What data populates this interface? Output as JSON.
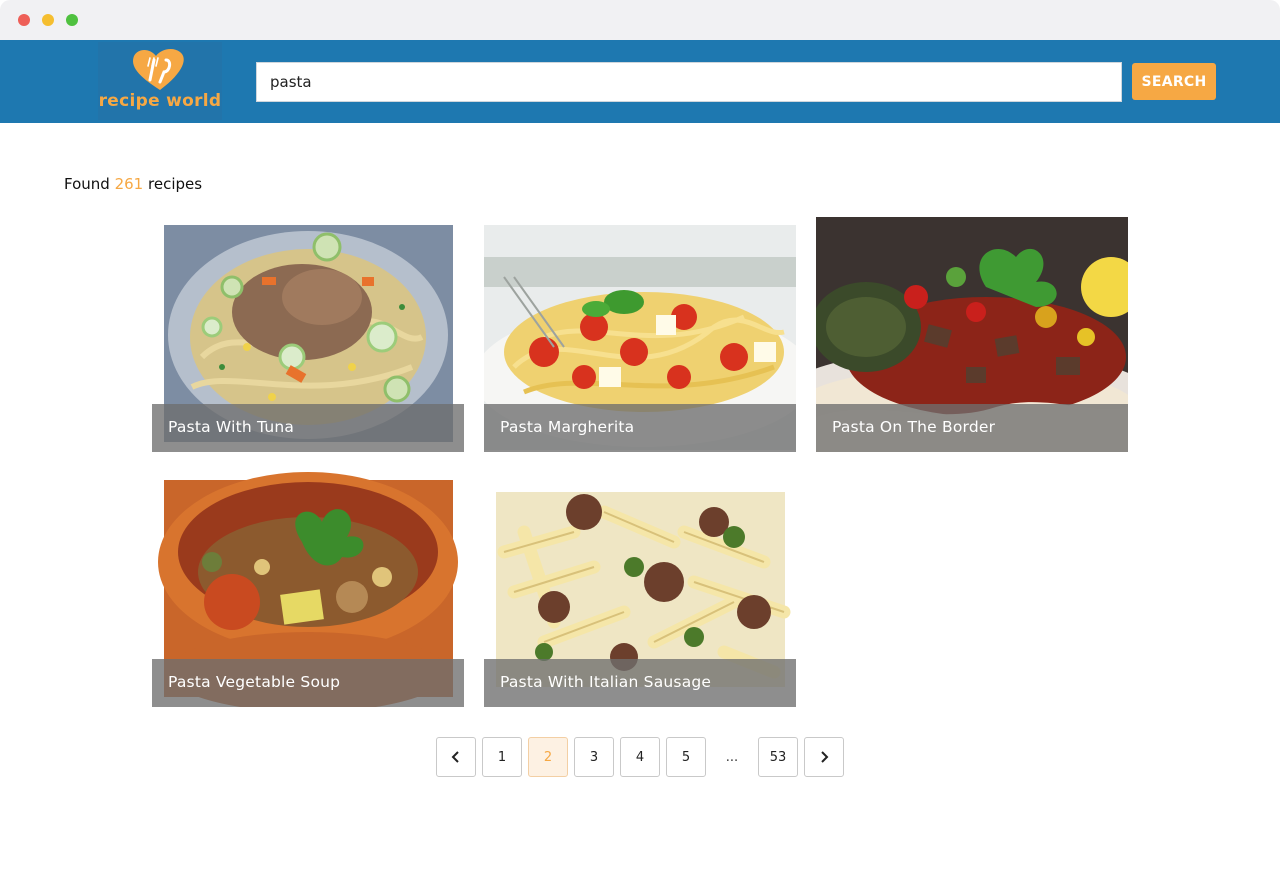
{
  "window": {
    "controls": [
      "close",
      "minimize",
      "maximize"
    ]
  },
  "header": {
    "logo_text": "recipe world",
    "search": {
      "value": "pasta",
      "placeholder": ""
    },
    "search_button_label": "SEARCH"
  },
  "results": {
    "prefix": "Found",
    "count": "261",
    "suffix": "recipes"
  },
  "recipes": [
    {
      "title": "Pasta With Tuna"
    },
    {
      "title": "Pasta Margherita"
    },
    {
      "title": "Pasta On The Border"
    },
    {
      "title": "Pasta Vegetable Soup"
    },
    {
      "title": "Pasta With Italian Sausage"
    }
  ],
  "pagination": {
    "prev_icon": "chevron-left-icon",
    "next_icon": "chevron-right-icon",
    "pages": [
      "1",
      "2",
      "3",
      "4",
      "5"
    ],
    "ellipsis": "...",
    "last_page": "53",
    "current_page": "2"
  },
  "colors": {
    "header": "#1e78b0",
    "accent": "#f6a844"
  }
}
